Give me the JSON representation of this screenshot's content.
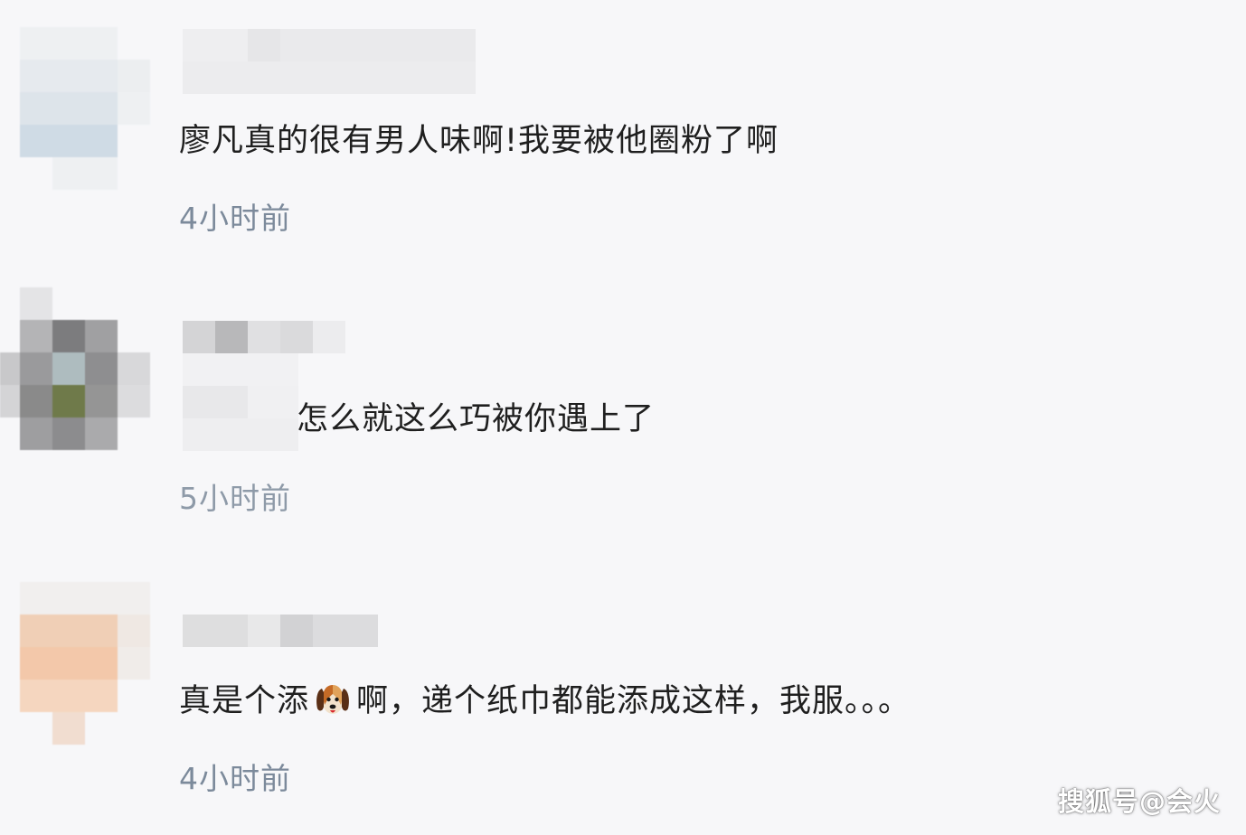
{
  "comments": [
    {
      "text": "廖凡真的很有男人味啊!我要被他圈粉了啊",
      "time": "4小时前"
    },
    {
      "text": "怎么就这么巧被你遇上了",
      "time": "5小时前"
    },
    {
      "text_before": "真是个添",
      "emoji": "dog-face-icon",
      "text_after": "啊，递个纸巾都能添成这样，我服。。。",
      "time": "4小时前"
    }
  ],
  "watermark": "搜狐号@会火",
  "colors": {
    "background": "#f7f7f9",
    "text": "#1f1f1f",
    "timestamp": "#7c8a9b"
  }
}
